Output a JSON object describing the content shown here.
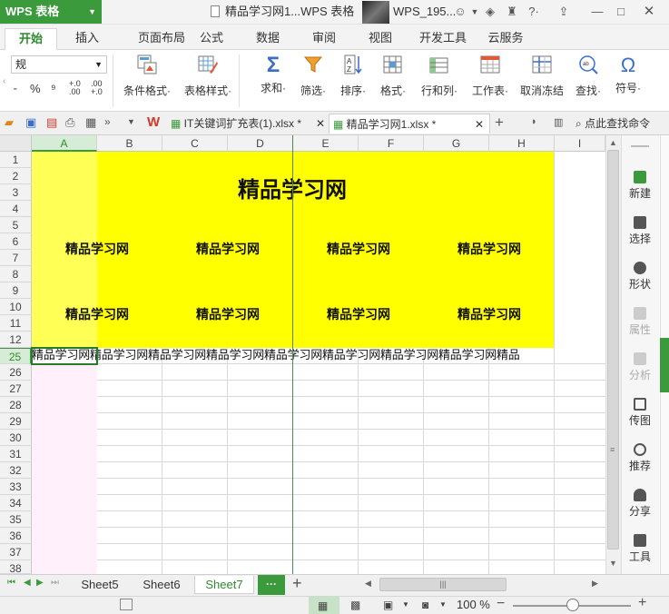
{
  "app": {
    "name": "WPS 表格",
    "doc_title": "精品学习网1...WPS 表格",
    "user": "WPS_195..."
  },
  "ribbon_tabs": [
    "开始",
    "插入",
    "页面布局",
    "公式",
    "数据",
    "审阅",
    "视图",
    "开发工具",
    "云服务"
  ],
  "ribbon": {
    "format_value": "规",
    "items": [
      "条件格式·",
      "表格样式·",
      "求和·",
      "筛选·",
      "排序·",
      "格式·",
      "行和列·",
      "工作表·",
      "取消冻结",
      "查找·",
      "符号·"
    ]
  },
  "doc_tabs": {
    "tab1": "IT关键词扩充表(1).xlsx *",
    "tab2": "精品学习网1.xlsx *",
    "search": "点此查找命令"
  },
  "columns": [
    "A",
    "B",
    "C",
    "D",
    "E",
    "F",
    "G",
    "H",
    "I"
  ],
  "rows": [
    "1",
    "2",
    "3",
    "4",
    "5",
    "6",
    "7",
    "8",
    "9",
    "10",
    "11",
    "12",
    "25",
    "26",
    "27",
    "28",
    "29",
    "30",
    "31",
    "32",
    "33",
    "34",
    "35",
    "36",
    "37",
    "38"
  ],
  "sheet": {
    "title": "精品学习网",
    "sub1": "精品学习网",
    "sub2": "精品学习网",
    "sub3": "精品学习网",
    "sub4": "精品学习网",
    "sub5": "精品学习网",
    "sub6": "精品学习网",
    "sub7": "精品学习网",
    "sub8": "精品学习网",
    "row25": "精品学习网精品学习网精品学习网精品学习网精品学习网精品学习网精品学习网精品学习网精品"
  },
  "right_panel": [
    "新建",
    "选择",
    "形状",
    "属性",
    "分析",
    "传图",
    "推荐",
    "分享",
    "工具"
  ],
  "sheet_tabs": [
    "Sheet5",
    "Sheet6",
    "Sheet7"
  ],
  "more_label": "···",
  "status": {
    "zoom": "100 %"
  },
  "colors": {
    "accent": "#3b9a3c",
    "highlight": "#ffff00"
  }
}
